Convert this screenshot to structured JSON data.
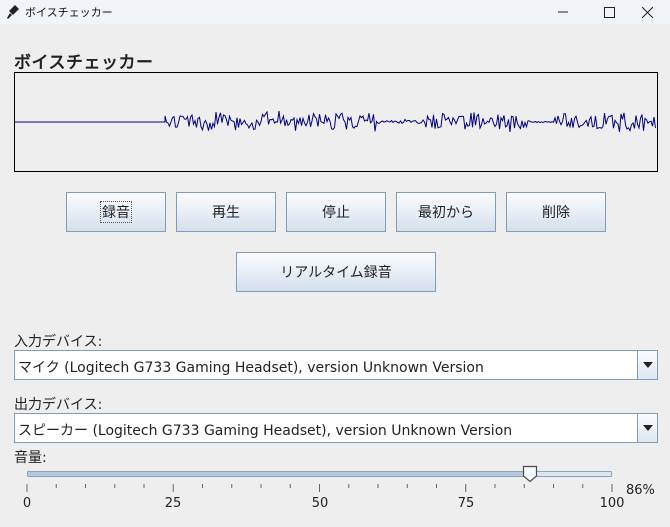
{
  "window": {
    "title": "ボイスチェッカー",
    "icons": {
      "app": "microphone-icon",
      "minimize": "minimize-icon",
      "maximize": "maximize-icon",
      "close": "close-icon"
    }
  },
  "heading": "ボイスチェッカー",
  "waveform": {
    "color": "#000080"
  },
  "buttons": {
    "record": "録音",
    "play": "再生",
    "stop": "停止",
    "restart": "最初から",
    "delete": "削除",
    "realtime": "リアルタイム録音"
  },
  "input_device": {
    "label": "入力デバイス:",
    "value": "マイク (Logitech G733 Gaming Headset), version Unknown Version"
  },
  "output_device": {
    "label": "出力デバイス:",
    "value": "スピーカー (Logitech G733 Gaming Headset), version Unknown Version"
  },
  "volume": {
    "label": "音量:",
    "min": 0,
    "max": 100,
    "value": 86,
    "percent_text": "86%",
    "ticks": [
      "0",
      "25",
      "50",
      "75",
      "100"
    ]
  }
}
